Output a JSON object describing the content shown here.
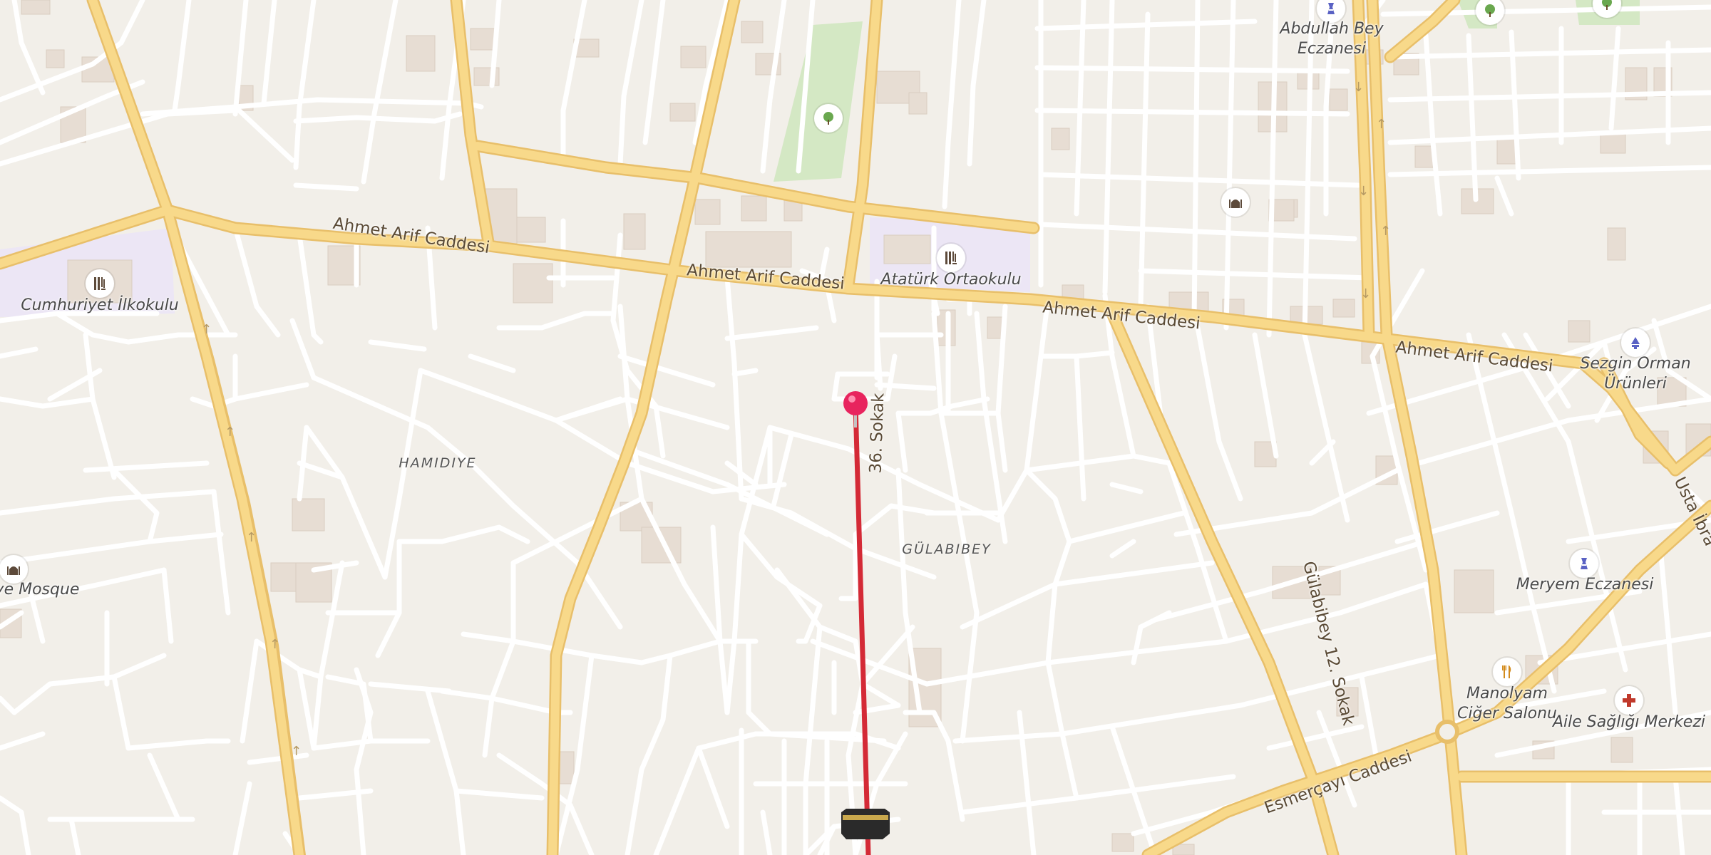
{
  "map": {
    "colors": {
      "background": "#f2efe9",
      "main_road": "#f8d98a",
      "main_road_casing": "#e8bf6a",
      "minor_road": "#ffffff",
      "park": "#d4e8c4",
      "school_area": "#ece6f5",
      "building": "#e7ddd3",
      "route_line": "#d42a36",
      "pin": "#e8245e"
    },
    "streets": [
      {
        "id": "ahmet-arif-1",
        "label": "Ahmet Arif Caddesi"
      },
      {
        "id": "ahmet-arif-2",
        "label": "Ahmet Arif Caddesi"
      },
      {
        "id": "ahmet-arif-3",
        "label": "Ahmet Arif Caddesi"
      },
      {
        "id": "ahmet-arif-4",
        "label": "Ahmet Arif Caddesi"
      },
      {
        "id": "sokak-36",
        "label": "36. Sokak"
      },
      {
        "id": "gulabibey-12",
        "label": "Gülabibey 12. Sokak"
      },
      {
        "id": "esmercayi",
        "label": "Esmerçayı Caddesi"
      },
      {
        "id": "usta-ibra",
        "label": "Usta İbra"
      }
    ],
    "districts": [
      {
        "id": "hamidiye",
        "label": "HAMIDIYE"
      },
      {
        "id": "gulabibey",
        "label": "GÜLABIBEY"
      }
    ],
    "pois": [
      {
        "id": "cumhuriyet",
        "label": "Cumhuriyet İlkokulu",
        "icon": "school-icon"
      },
      {
        "id": "ataturk",
        "label": "Atatürk Ortaokulu",
        "icon": "school-icon"
      },
      {
        "id": "abdullah",
        "label": "Abdullah Bey\nEczanesi",
        "icon": "pharmacy-icon"
      },
      {
        "id": "sezgin",
        "label": "Sezgin Orman\nÜrünleri",
        "icon": "shop-icon"
      },
      {
        "id": "meryem",
        "label": "Meryem Eczanesi",
        "icon": "pharmacy-icon"
      },
      {
        "id": "manolyam",
        "label": "Manolyam\nCiğer Salonu",
        "icon": "restaurant-icon"
      },
      {
        "id": "aile",
        "label": "Aile Sağlığı Merkezi",
        "icon": "clinic-icon"
      },
      {
        "id": "mosque",
        "label": "ye Mosque",
        "icon": "mosque-icon"
      }
    ],
    "markers": [
      {
        "id": "location-pin",
        "icon": "pin-icon"
      },
      {
        "id": "kaaba",
        "icon": "kaaba-icon"
      }
    ]
  }
}
